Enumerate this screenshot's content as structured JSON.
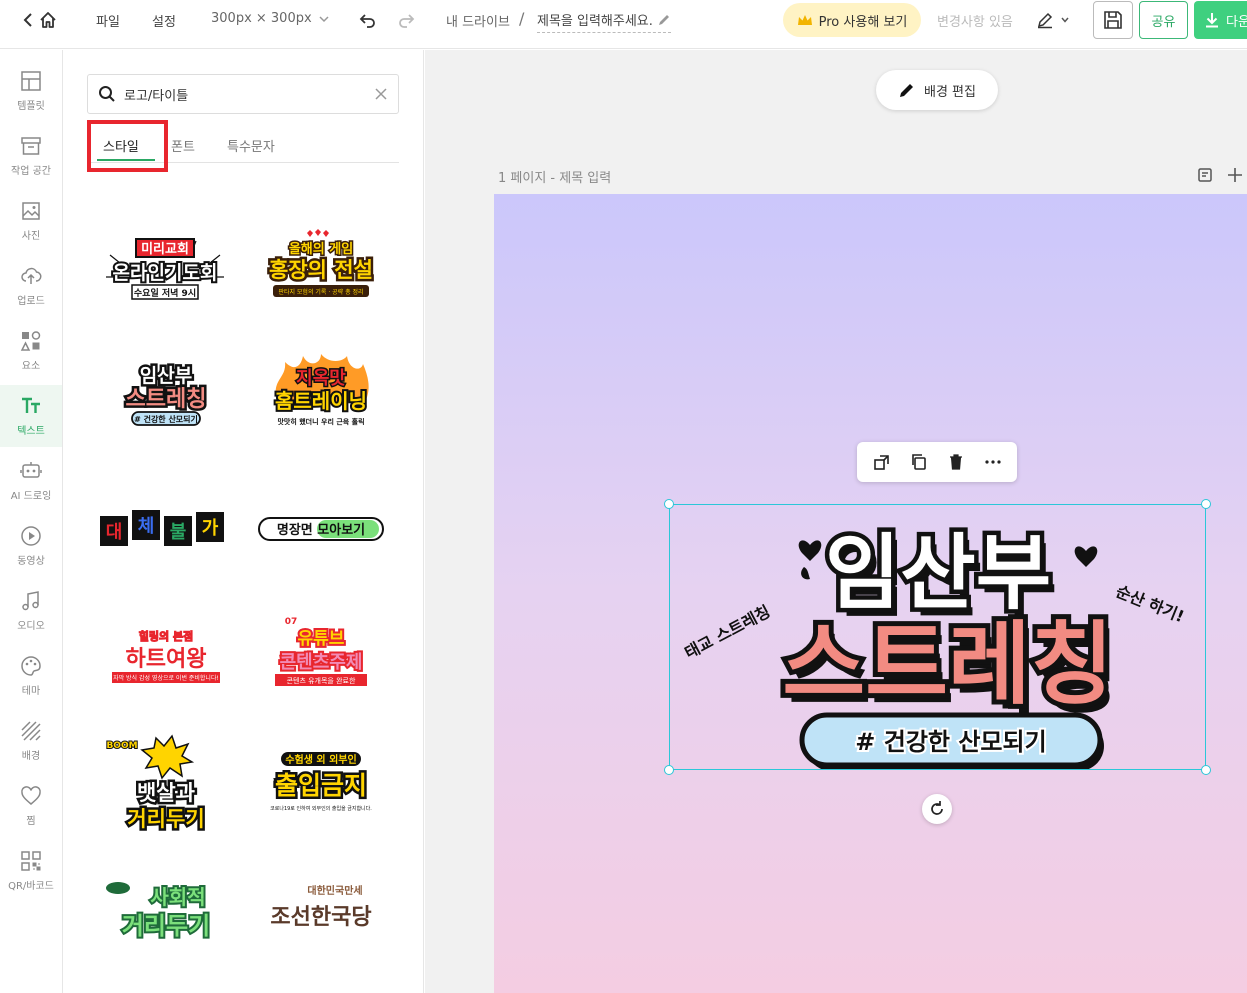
{
  "topbar": {
    "menu_file": "파일",
    "menu_settings": "설정",
    "canvas_size": "300px × 300px",
    "breadcrumb_drive": "내 드라이브",
    "breadcrumb_sep": "/",
    "title_placeholder": "제목을 입력해주세요.",
    "pro_label": "Pro 사용해 보기",
    "save_status": "변경사항 있음",
    "share_label": "공유",
    "download_label": "다운"
  },
  "rail": {
    "items": [
      {
        "label": "템플릿",
        "icon": "template-icon"
      },
      {
        "label": "작업 공간",
        "icon": "workspace-icon"
      },
      {
        "label": "사진",
        "icon": "photo-icon"
      },
      {
        "label": "업로드",
        "icon": "upload-icon"
      },
      {
        "label": "요소",
        "icon": "elements-icon"
      },
      {
        "label": "텍스트",
        "icon": "text-icon",
        "active": true
      },
      {
        "label": "AI 드로잉",
        "icon": "ai-drawing-icon"
      },
      {
        "label": "동영상",
        "icon": "video-icon"
      },
      {
        "label": "오디오",
        "icon": "audio-icon"
      },
      {
        "label": "테마",
        "icon": "theme-icon"
      },
      {
        "label": "배경",
        "icon": "background-icon"
      },
      {
        "label": "찜",
        "icon": "heart-icon"
      },
      {
        "label": "QR/바코드",
        "icon": "qr-icon"
      }
    ]
  },
  "panel": {
    "search_value": "로고/타이틀",
    "tabs": [
      "스타일",
      "폰트",
      "특수문자"
    ],
    "active_tab": "스타일",
    "stickers": [
      {
        "lines": [
          "미리교회",
          "온라인기도회",
          "수요일 저녁 9시"
        ],
        "colors": [
          "#e8262e",
          "#ffffff",
          "#ffd400"
        ]
      },
      {
        "lines": [
          "올해의 게임",
          "홍장의 전설",
          "판타지 모험의 기록 · 공략 총 정리"
        ],
        "colors": [
          "#ffd400",
          "#ff6b1a",
          "#6a3b1a"
        ]
      },
      {
        "lines": [
          "임산부",
          "스트레칭",
          "# 건강한 산모되기"
        ],
        "colors": [
          "#ffffff",
          "#f28b82",
          "#bfe3f7"
        ]
      },
      {
        "lines": [
          "지옥맛",
          "홈트레이닝",
          "맛맛히 했더니 우리 근육 홀릭"
        ],
        "colors": [
          "#e8262e",
          "#ffd400",
          "#ff8a00"
        ]
      },
      {
        "lines": [
          "대",
          "체",
          "불",
          "가"
        ],
        "colors": [
          "#e8262e",
          "#3a6df0",
          "#2aa864",
          "#ffd400"
        ]
      },
      {
        "lines": [
          "명장면 모아보기"
        ],
        "colors": [
          "#7be07b",
          "#ffffff"
        ]
      },
      {
        "lines": [
          "힐링의 본점",
          "하트여왕",
          "자막 방식 감성 영상으로 이번 준비합니다!"
        ],
        "colors": [
          "#e8262e",
          "#f7b1c6"
        ]
      },
      {
        "lines": [
          "07",
          "유튜브",
          "콘텐츠주제",
          "콘텐츠 유개목을 완료한"
        ],
        "colors": [
          "#e8262e",
          "#ffd400",
          "#f28bb5"
        ]
      },
      {
        "lines": [
          "BOOM",
          "뱃살과",
          "거리두기"
        ],
        "colors": [
          "#ffd400",
          "#111111"
        ]
      },
      {
        "lines": [
          "수험생 외 외부인",
          "출입금지",
          "코로나19로 인하여 외부인의 출입을 금지합니다."
        ],
        "colors": [
          "#ffd400",
          "#111111"
        ]
      },
      {
        "lines": [
          "사회적",
          "거리두기"
        ],
        "colors": [
          "#7be07b",
          "#1f6b3a"
        ]
      },
      {
        "lines": [
          "대한민국만세",
          "조선한국당"
        ],
        "colors": [
          "#5a3a2a",
          "#8a5a3a"
        ]
      }
    ]
  },
  "canvas": {
    "bg_edit_label": "배경 편집",
    "page_label": "1 페이지 - 제목 입력",
    "artwork": {
      "line1": "임산부",
      "line2": "스트레칭",
      "tag": "# 건강한 산모되기",
      "side_left": "태교 스트레칭",
      "side_right": "순산 하기!"
    },
    "colors": {
      "accent": "#2aa864",
      "selection": "#2bc7d8",
      "salmon": "#f28b82",
      "tag_bg": "#bfe3f7"
    }
  }
}
